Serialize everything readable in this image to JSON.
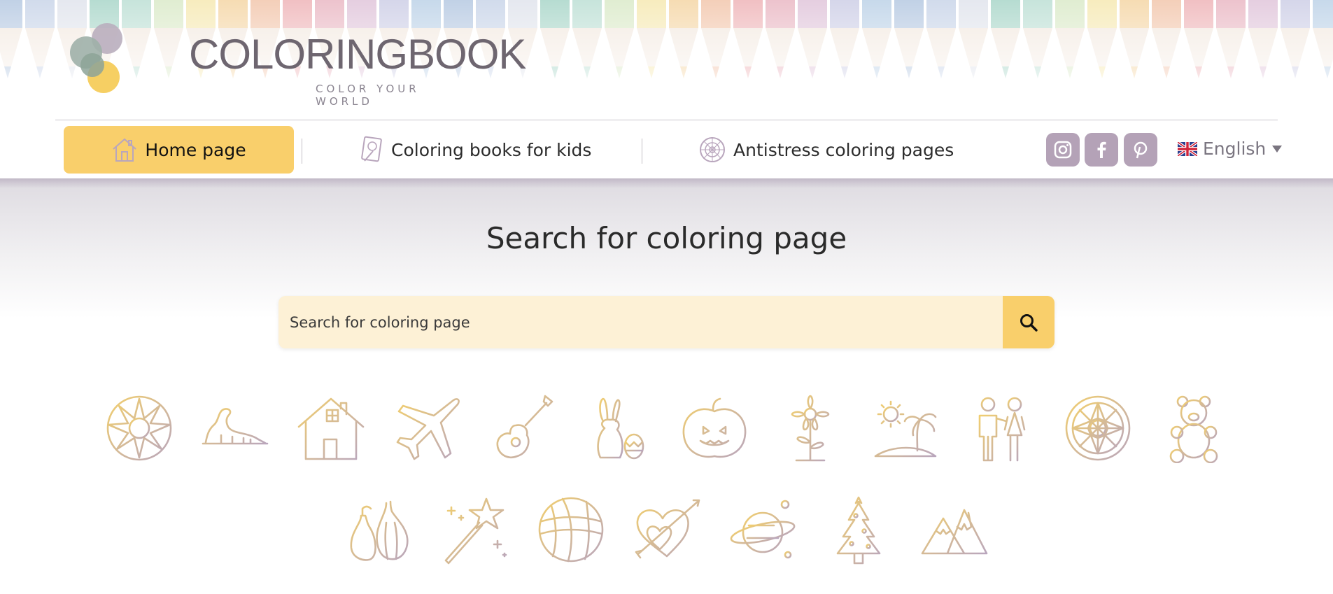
{
  "brand": {
    "name": "COLORINGBOOK",
    "tagline": "COLOR YOUR WORLD"
  },
  "nav": {
    "items": [
      {
        "label": "Home page",
        "icon": "house-icon",
        "active": true
      },
      {
        "label": "Coloring books for kids",
        "icon": "coloring-book-icon",
        "active": false
      },
      {
        "label": "Antistress coloring pages",
        "icon": "mandala-icon",
        "active": false
      }
    ],
    "social": [
      "instagram-icon",
      "facebook-icon",
      "pinterest-icon"
    ],
    "language": {
      "label": "English",
      "flag": "uk-flag-icon"
    }
  },
  "hero": {
    "title": "Search for coloring page",
    "search": {
      "placeholder": "Search for coloring page",
      "value": ""
    }
  },
  "categories": [
    {
      "icon": "mandala-sun-icon"
    },
    {
      "icon": "dinosaur-icon"
    },
    {
      "icon": "house-icon"
    },
    {
      "icon": "airplane-icon"
    },
    {
      "icon": "guitar-icon"
    },
    {
      "icon": "easter-bunny-icon"
    },
    {
      "icon": "pumpkin-icon"
    },
    {
      "icon": "flower-icon"
    },
    {
      "icon": "beach-palm-icon"
    },
    {
      "icon": "couple-icon"
    },
    {
      "icon": "mandala-icon"
    },
    {
      "icon": "teddy-bear-icon"
    },
    {
      "icon": "fruit-vegetables-icon"
    },
    {
      "icon": "magic-wand-icon"
    },
    {
      "icon": "ball-icon"
    },
    {
      "icon": "hearts-icon"
    },
    {
      "icon": "planet-icon"
    },
    {
      "icon": "christmas-tree-icon"
    },
    {
      "icon": "mountains-icon"
    }
  ],
  "colors": {
    "accent": "#f9cf6b",
    "search_bg": "#fdf1d6",
    "social": "#b4a2b7",
    "icon_gradient_from": "#f2cf6e",
    "icon_gradient_to": "#b9a6bd"
  }
}
